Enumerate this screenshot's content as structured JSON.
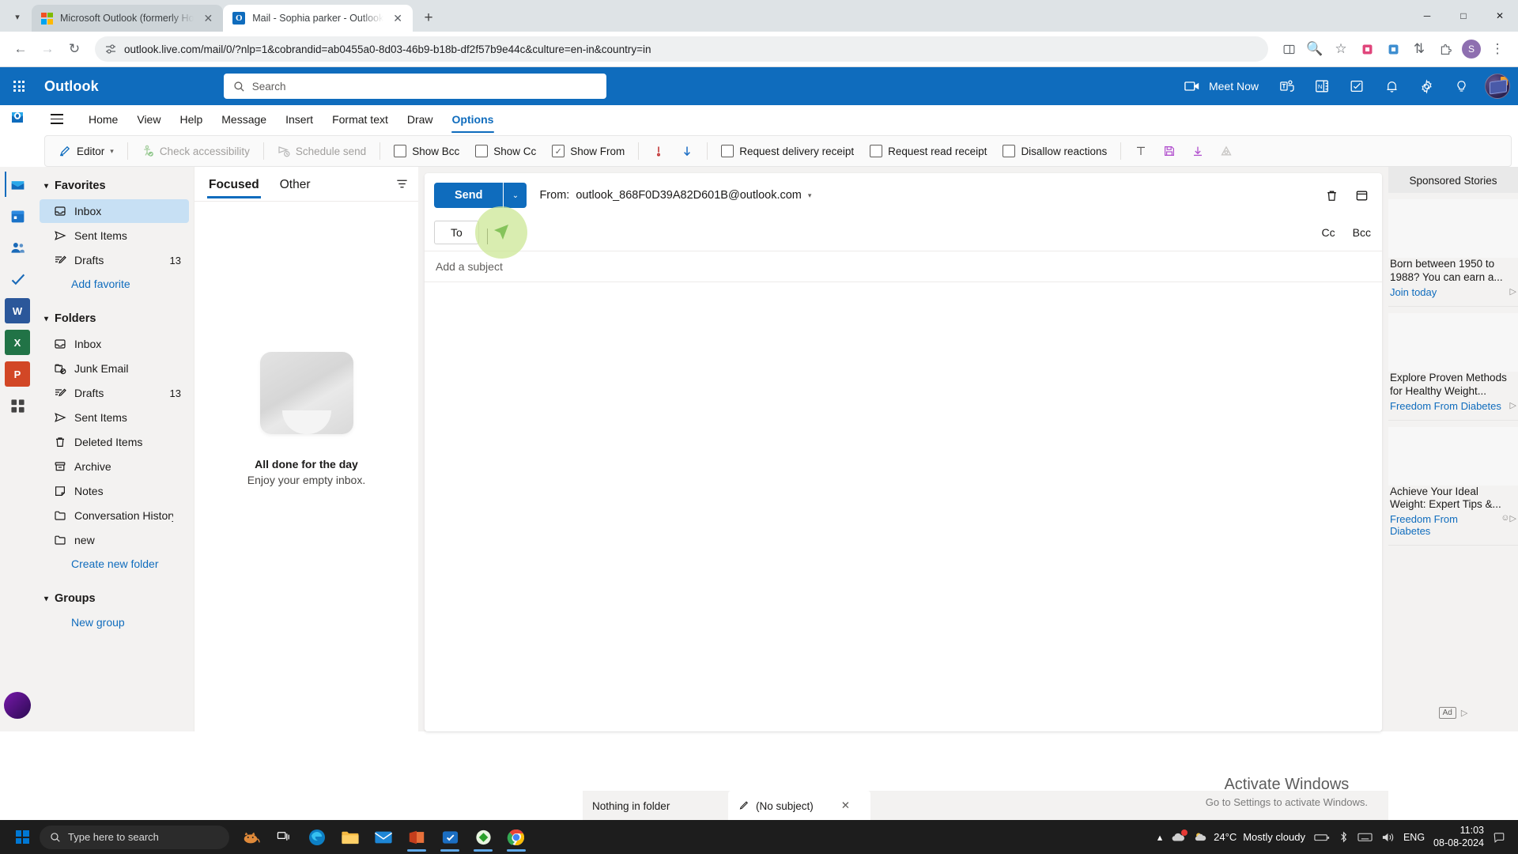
{
  "browser": {
    "tabs": [
      {
        "title": "Microsoft Outlook (formerly Ho",
        "favicon": "microsoft-icon",
        "active": false
      },
      {
        "title": "Mail - Sophia parker - Outlook",
        "favicon": "outlook-icon",
        "active": true
      }
    ],
    "new_tab_label": "+",
    "url": "outlook.live.com/mail/0/?nlp=1&cobrandid=ab0455a0-8d03-46b9-b18b-df2f57b9e44c&culture=en-in&country=in",
    "profile_initial": "S",
    "window_controls": {
      "minimize": "—",
      "maximize": "□",
      "close": "✕"
    },
    "nav": {
      "back": "←",
      "forward": "→",
      "reload": "↻"
    }
  },
  "outlook_header": {
    "brand": "Outlook",
    "search_placeholder": "Search",
    "meet_now": "Meet Now",
    "icons": [
      "teams-icon",
      "onenote-icon",
      "todo-icon",
      "notification-bell-icon",
      "settings-gear-icon",
      "tips-lightbulb-icon"
    ]
  },
  "ribbon": {
    "tabs": [
      {
        "label": "Home",
        "selected": false
      },
      {
        "label": "View",
        "selected": false
      },
      {
        "label": "Help",
        "selected": false
      },
      {
        "label": "Message",
        "selected": false
      },
      {
        "label": "Insert",
        "selected": false
      },
      {
        "label": "Format text",
        "selected": false
      },
      {
        "label": "Draw",
        "selected": false
      },
      {
        "label": "Options",
        "selected": true
      }
    ],
    "commands": {
      "editor": "Editor",
      "check_accessibility": "Check accessibility",
      "schedule_send": "Schedule send",
      "show_bcc": "Show Bcc",
      "show_cc": "Show Cc",
      "show_from": "Show From",
      "request_delivery_receipt": "Request delivery receipt",
      "request_read_receipt": "Request read receipt",
      "disallow_reactions": "Disallow reactions"
    },
    "checkbox_states": {
      "show_bcc": false,
      "show_cc": false,
      "show_from": true,
      "request_delivery_receipt": false,
      "request_read_receipt": false,
      "disallow_reactions": false
    }
  },
  "folder_pane": {
    "favorites": {
      "title": "Favorites",
      "items": [
        {
          "label": "Inbox",
          "icon": "inbox-icon",
          "count": "",
          "selected": true
        },
        {
          "label": "Sent Items",
          "icon": "send-icon",
          "count": "",
          "selected": false
        },
        {
          "label": "Drafts",
          "icon": "draft-pencil-icon",
          "count": "13",
          "selected": false
        }
      ],
      "add_link": "Add favorite"
    },
    "folders": {
      "title": "Folders",
      "items": [
        {
          "label": "Inbox",
          "icon": "inbox-icon",
          "count": ""
        },
        {
          "label": "Junk Email",
          "icon": "junk-icon",
          "count": ""
        },
        {
          "label": "Drafts",
          "icon": "draft-pencil-icon",
          "count": "13"
        },
        {
          "label": "Sent Items",
          "icon": "send-icon",
          "count": ""
        },
        {
          "label": "Deleted Items",
          "icon": "trash-icon",
          "count": ""
        },
        {
          "label": "Archive",
          "icon": "archive-icon",
          "count": ""
        },
        {
          "label": "Notes",
          "icon": "notes-icon",
          "count": ""
        },
        {
          "label": "Conversation History",
          "icon": "folder-icon",
          "count": ""
        },
        {
          "label": "new",
          "icon": "folder-icon",
          "count": ""
        }
      ],
      "create_link": "Create new folder"
    },
    "groups": {
      "title": "Groups",
      "new_link": "New group"
    }
  },
  "message_list": {
    "pivots": [
      {
        "label": "Focused",
        "active": true
      },
      {
        "label": "Other",
        "active": false
      }
    ],
    "filter_icon": "filter-icon",
    "empty_title": "All done for the day",
    "empty_subtitle": "Enjoy your empty inbox.",
    "footer": "Nothing in folder"
  },
  "compose": {
    "send_label": "Send",
    "send_caret": "⌄",
    "from_prefix": "From:",
    "from_address": "outlook_868F0D39A82D601B@outlook.com",
    "to_label": "To",
    "to_value": "",
    "cc_label": "Cc",
    "bcc_label": "Bcc",
    "subject_placeholder": "Add a subject",
    "body_value": "",
    "discard_icon": "trash-icon",
    "popout_icon": "popout-icon",
    "draft_tab_label": "(No subject)",
    "draft_tab_icon": "pencil-icon",
    "draft_tab_close": "✕"
  },
  "ads": {
    "title": "Sponsored Stories",
    "items": [
      {
        "headline": "Born between 1950 to 1988? You can earn a...",
        "advertiser": "Join today"
      },
      {
        "headline": "Explore Proven Methods for Healthy Weight...",
        "advertiser": "Freedom From Diabetes"
      },
      {
        "headline": "Achieve Your Ideal Weight: Expert Tips &...",
        "advertiser": "Freedom From Diabetes"
      }
    ],
    "badge": "Ad"
  },
  "watermark": {
    "line1": "Activate Windows",
    "line2": "Go to Settings to activate Windows."
  },
  "taskbar": {
    "search_placeholder": "Type here to search",
    "weather_temp": "24°C",
    "weather_desc": "Mostly cloudy",
    "language": "ENG",
    "time": "11:03",
    "date": "08-08-2024",
    "apps": [
      "task-view-icon",
      "edge-icon",
      "file-explorer-icon",
      "mail-icon",
      "office-icon",
      "store-icon",
      "anydesk-icon",
      "chrome-icon"
    ]
  },
  "colors": {
    "outlook_blue": "#0f6cbd",
    "selection_blue": "#c7e0f4",
    "cursor_green": "#8cc63f",
    "accent_purple": "#b14fce"
  }
}
